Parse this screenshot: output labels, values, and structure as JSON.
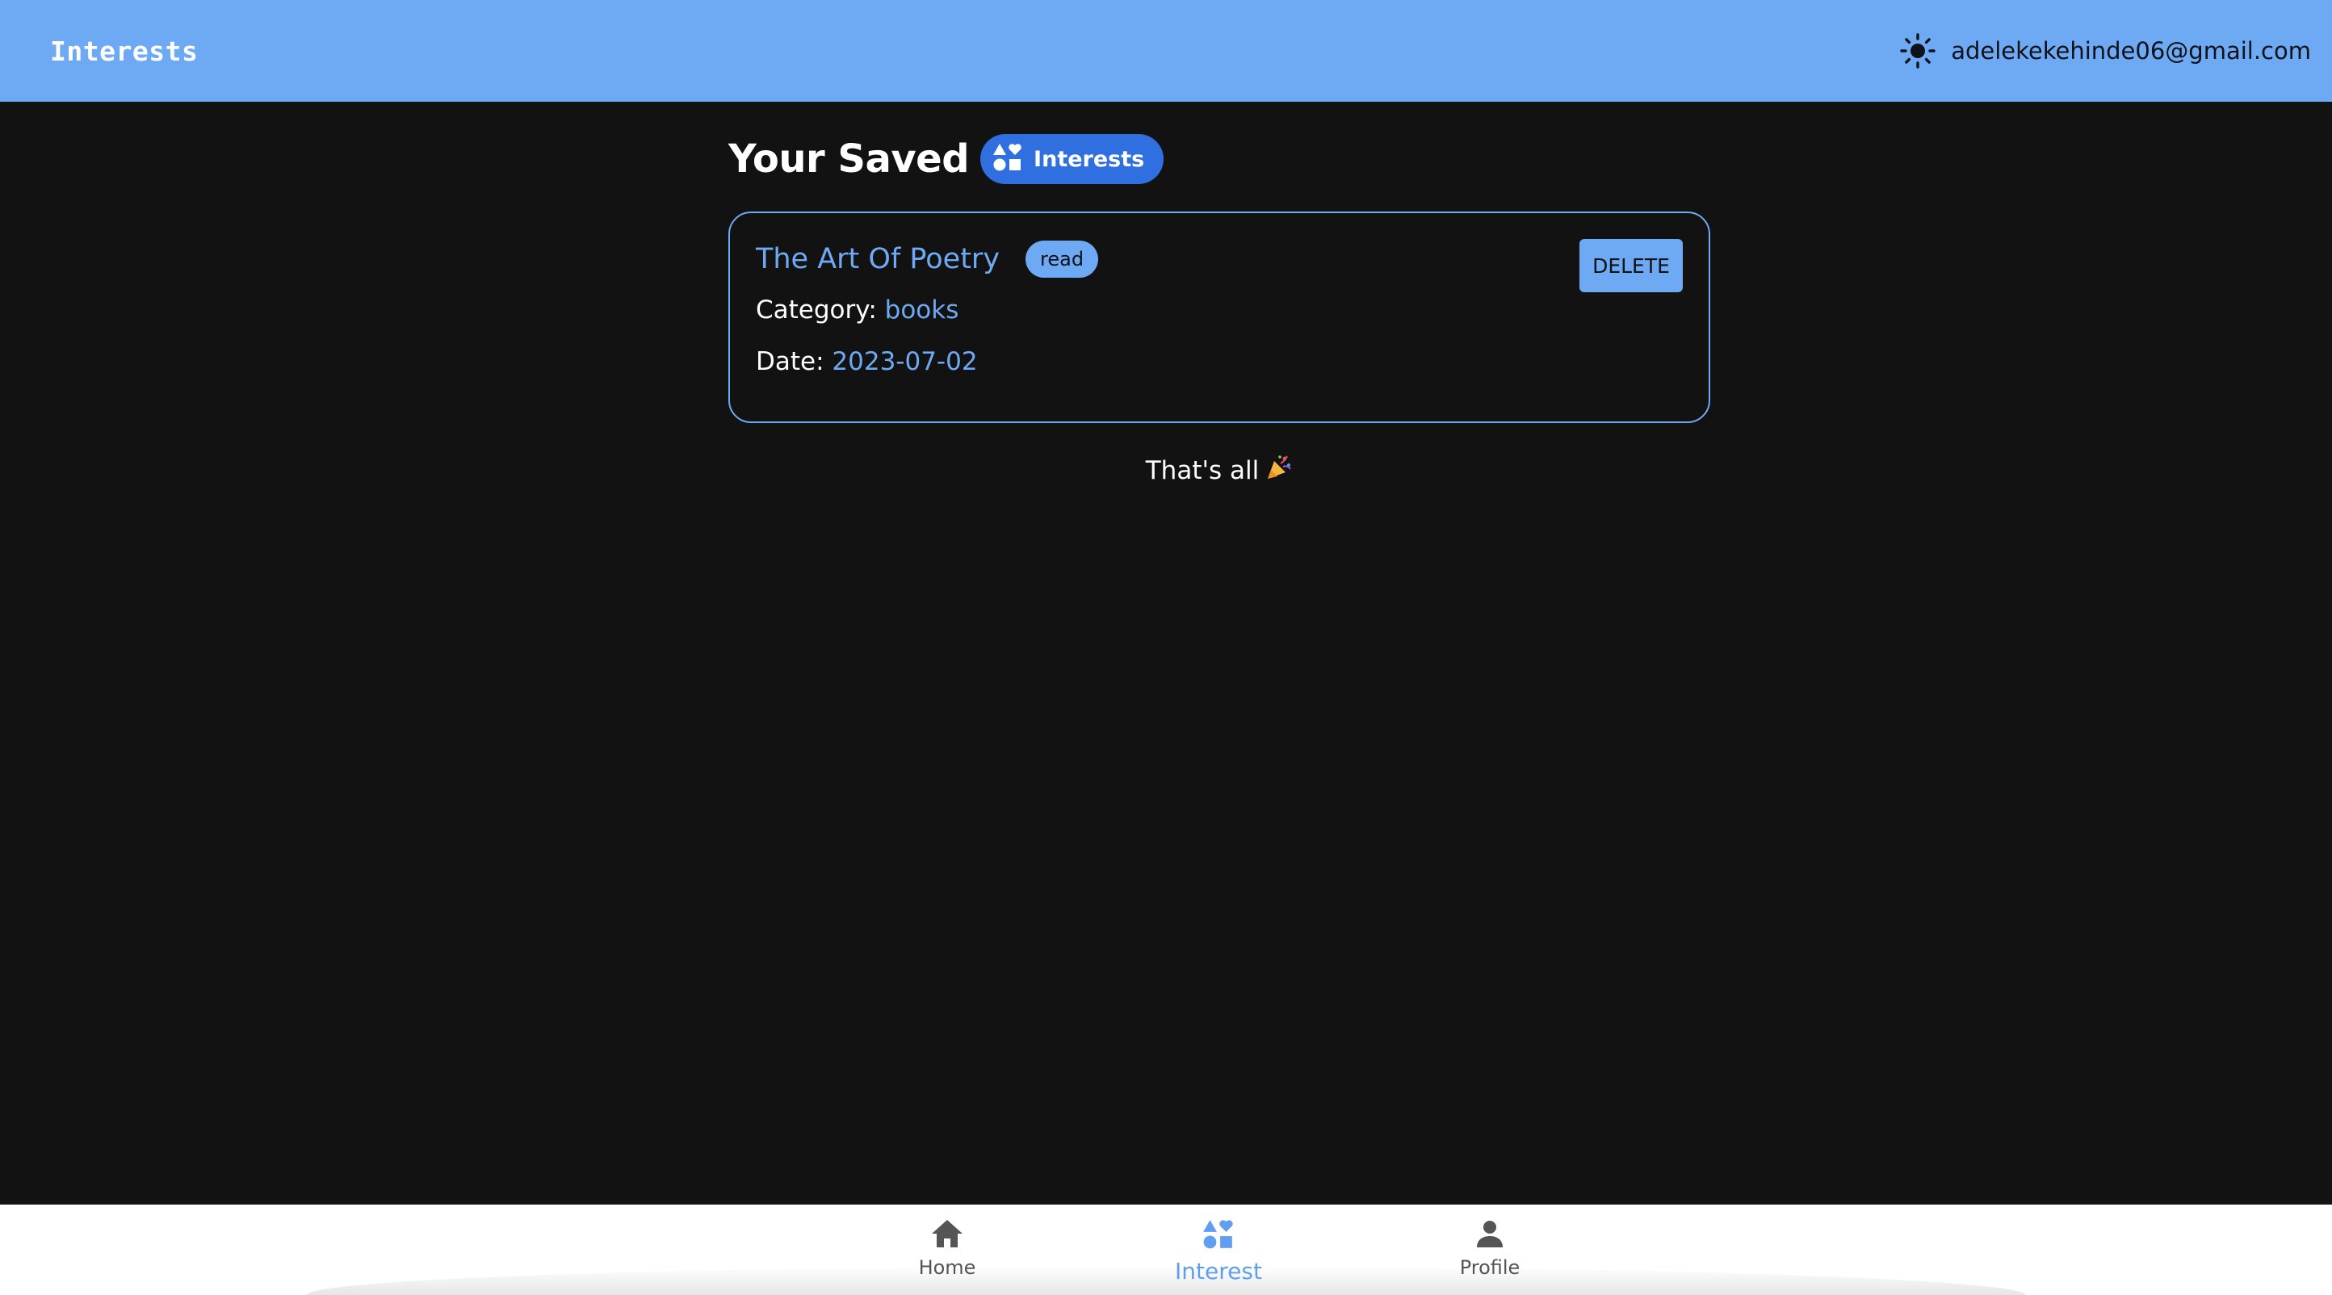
{
  "appbar": {
    "title": "Interests",
    "user_email": "adelekekehinde06@gmail.com",
    "theme_icon": "sun-icon"
  },
  "page": {
    "heading": "Your Saved",
    "chip_label": "Interests",
    "chip_icon": "interests-icon"
  },
  "items": [
    {
      "title": "The Art Of Poetry",
      "badge": "read",
      "category_label": "Category:",
      "category": "books",
      "date_label": "Date:",
      "date": "2023-07-02",
      "delete_label": "DELETE"
    }
  ],
  "end_message": "That's all",
  "end_icon": "party-popper-icon",
  "bottom_nav": [
    {
      "label": "Home",
      "icon": "home-icon",
      "active": false
    },
    {
      "label": "Interest",
      "icon": "interests-icon",
      "active": true
    },
    {
      "label": "Profile",
      "icon": "person-icon",
      "active": false
    }
  ],
  "colors": {
    "appbar": "#6eaaf4",
    "background": "#121212",
    "accent": "#6eaaf4",
    "chip": "#2f6fe0",
    "nav_active": "#5f9ef0"
  }
}
